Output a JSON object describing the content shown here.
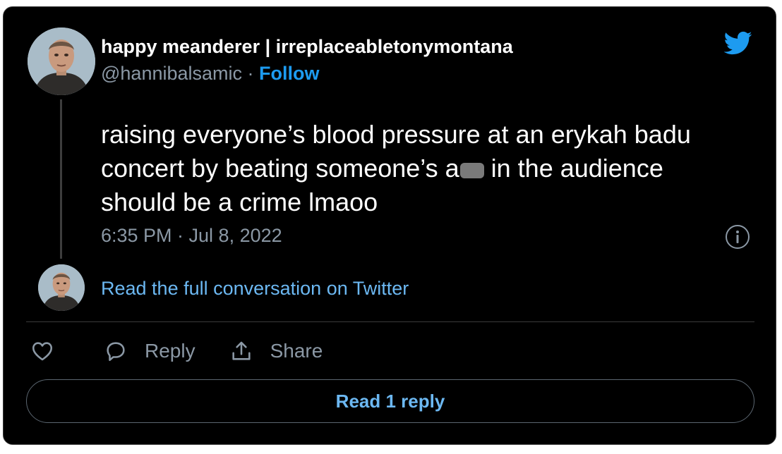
{
  "author": {
    "display_name": "happy meanderer | irreplaceabletonymontana",
    "handle": "@hannibalsamic",
    "separator": "·",
    "follow_label": "Follow"
  },
  "tweet": {
    "line1": "raising everyone’s blood pressure at an erykah badu",
    "line2_before": "concert by beating someone’s a",
    "line2_after": " in the audience",
    "line3": "should be a crime lmaoo",
    "timestamp": "6:35 PM · Jul 8, 2022"
  },
  "thread": {
    "read_conversation_label": "Read the full conversation on Twitter"
  },
  "actions": {
    "reply_label": "Reply",
    "share_label": "Share"
  },
  "footer": {
    "read_replies_label": "Read 1 reply"
  },
  "icons": {
    "brand": "twitter-bird-icon",
    "info": "info-icon",
    "like": "heart-icon",
    "reply": "speech-bubble-icon",
    "share": "share-upload-icon"
  },
  "colors": {
    "background": "#000000",
    "accent": "#1d9bf0",
    "link": "#6cb8f2",
    "muted": "#8b98a5",
    "text": "#ffffff"
  }
}
